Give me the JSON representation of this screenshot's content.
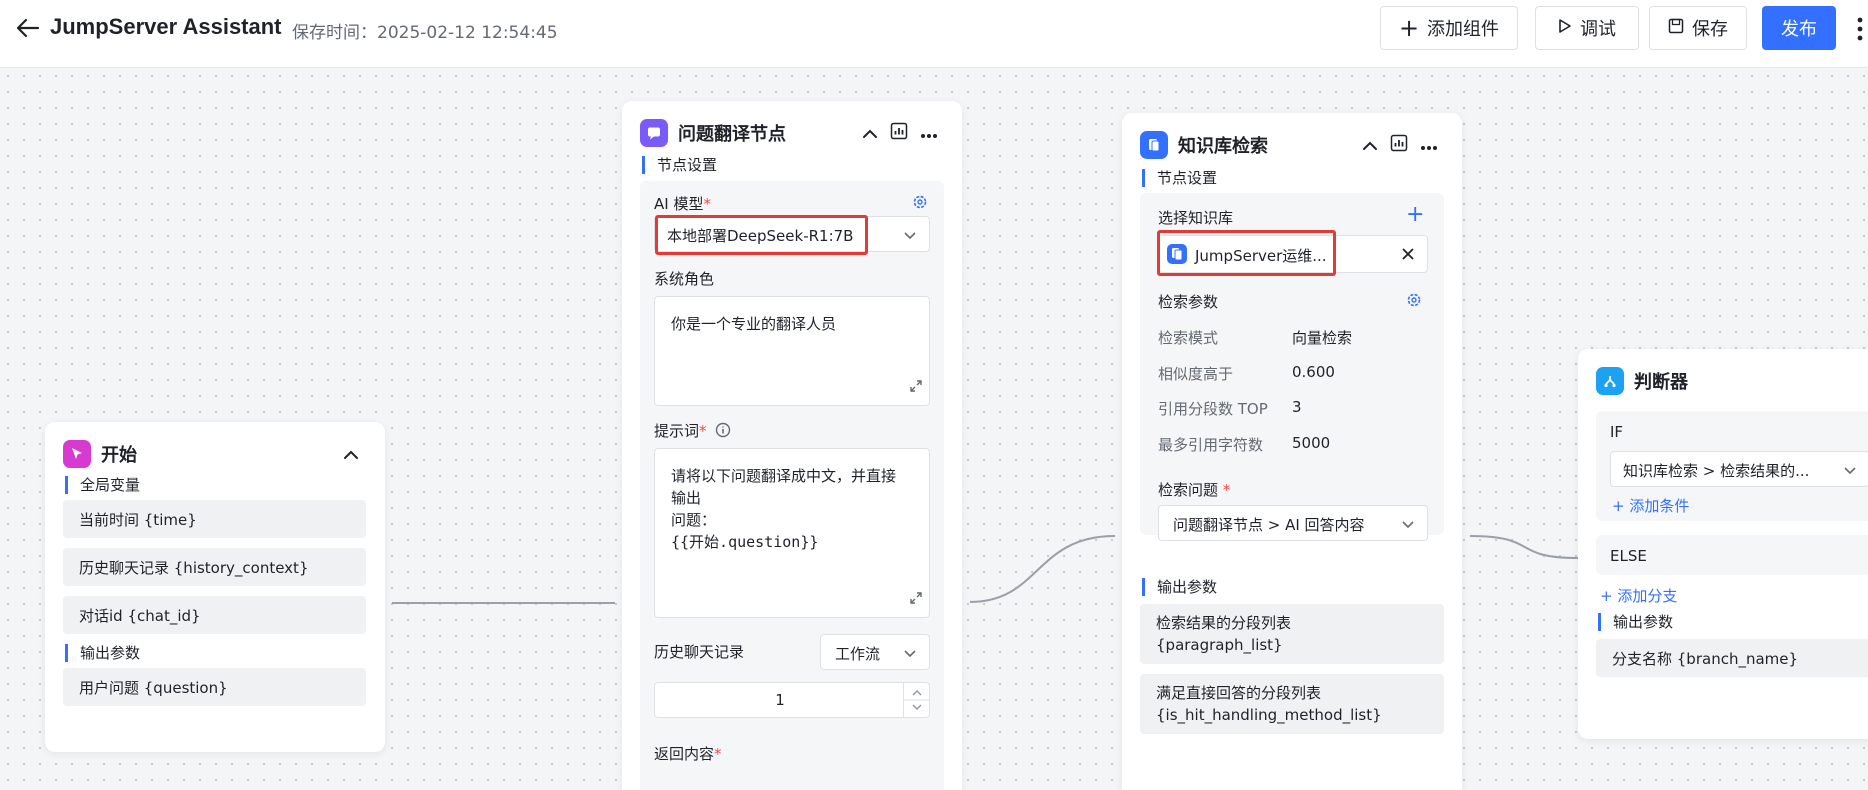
{
  "header": {
    "app_title": "JumpServer Assistant",
    "save_time": "保存时间：2025-02-12 12:54:45",
    "add_component_label": "添加组件",
    "debug_label": "调试",
    "save_label": "保存",
    "publish_label": "发布"
  },
  "start_node": {
    "title": "开始",
    "global_vars_label": "全局变量",
    "global_vars": [
      "当前时间 {time}",
      "历史聊天记录 {history_context}",
      "对话id {chat_id}"
    ],
    "output_label": "输出参数",
    "outputs": [
      "用户问题 {question}"
    ]
  },
  "translate_node": {
    "title": "问题翻译节点",
    "settings_label": "节点设置",
    "ai_model_label": "AI 模型",
    "ai_model_value": "本地部署DeepSeek-R1:7B",
    "system_role_label": "系统角色",
    "system_role_value": "你是一个专业的翻译人员",
    "prompt_label": "提示词",
    "prompt_lines": [
      "请将以下问题翻译成中文，并直接",
      "输出",
      "问题：",
      "{{开始.question}}"
    ],
    "history_label": "历史聊天记录",
    "history_source": "工作流",
    "history_count": "1",
    "return_label": "返回内容"
  },
  "kb_node": {
    "title": "知识库检索",
    "settings_label": "节点设置",
    "select_kb_label": "选择知识库",
    "kb_name": "JumpServer运维...",
    "search_params_label": "检索参数",
    "params": [
      {
        "key": "检索模式",
        "value": "向量检索"
      },
      {
        "key": "相似度高于",
        "value": "0.600"
      },
      {
        "key": "引用分段数 TOP",
        "value": "3"
      },
      {
        "key": "最多引用字符数",
        "value": "5000"
      }
    ],
    "question_label": "检索问题",
    "question_value": "问题翻译节点 > AI 回答内容",
    "output_label": "输出参数",
    "outputs": [
      {
        "line1": "检索结果的分段列表",
        "line2": "{paragraph_list}"
      },
      {
        "line1": "满足直接回答的分段列表",
        "line2": "{is_hit_handling_method_list}"
      }
    ]
  },
  "judge_node": {
    "title": "判断器",
    "if_label": "IF",
    "condition_value": "知识库检索 > 检索结果的...",
    "add_condition_label": "添加条件",
    "else_label": "ELSE",
    "add_branch_label": "添加分支",
    "output_label": "输出参数",
    "outputs": [
      "分支名称 {branch_name}"
    ]
  },
  "colors": {
    "primary": "#3370ff",
    "start_icon": "#d63ad1",
    "translate_icon": "#7a5af8",
    "kb_icon": "#3370ff",
    "judge_icon": "#1da1f2",
    "highlight": "#e53935"
  }
}
